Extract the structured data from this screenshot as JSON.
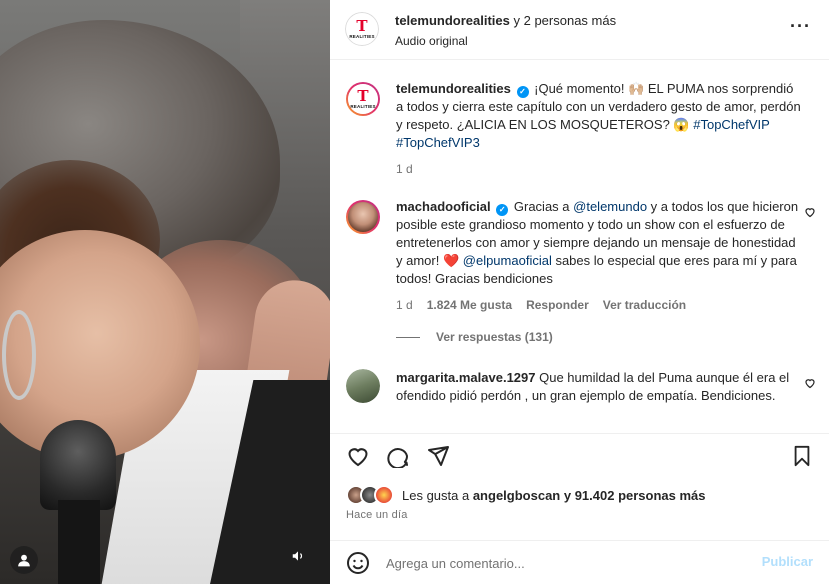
{
  "header": {
    "username": "telemundorealities",
    "others": "y 2 personas más",
    "subtitle": "Audio original",
    "logo_text": "T",
    "logo_sub": "REALITIES",
    "more_icon": "more-dots-icon"
  },
  "caption": {
    "username": "telemundorealities",
    "text": "¡Qué momento! 🙌🏼 EL PUMA nos sorprendió a todos y cierra este capítulo con un verdadero gesto de amor, perdón y respeto. ¿ALICIA EN LOS MOSQUETEROS? 😱",
    "hashtags": "#TopChefVIP #TopChefVIP3",
    "time": "1 d"
  },
  "comments": [
    {
      "username": "machadooficial",
      "verified": true,
      "text_1": "Gracias a ",
      "mention_1": "@telemundo",
      "text_2": " y a todos los que hicieron posible este grandioso momento y todo un show con el esfuerzo de entretenerlos con amor y siempre dejando un mensaje de honestidad y amor! ❤️ ",
      "mention_2": "@elpumaoficial",
      "text_3": " sabes lo especial que eres para mí y para todos! Gracias bendiciones",
      "time": "1 d",
      "likes": "1.824 Me gusta",
      "reply": "Responder",
      "translate": "Ver traducción",
      "replies": "Ver respuestas (131)"
    },
    {
      "username": "margarita.malave.1297",
      "text": "Que humildad la del Puma aunque él era el ofendido pidió perdón , un gran ejemplo de empatía. Bendiciones."
    }
  ],
  "actions": {
    "likes_prefix": "Les gusta a ",
    "likes_user": "angelgboscan",
    "likes_suffix": " y 91.402 personas más",
    "time": "Hace un día",
    "comment_placeholder": "Agrega un comentario...",
    "publish": "Publicar"
  },
  "colors": {
    "verified": "#0095f6",
    "link": "#00376b",
    "publish_disabled": "#b2dffc",
    "heart_red": "#e0245e"
  }
}
